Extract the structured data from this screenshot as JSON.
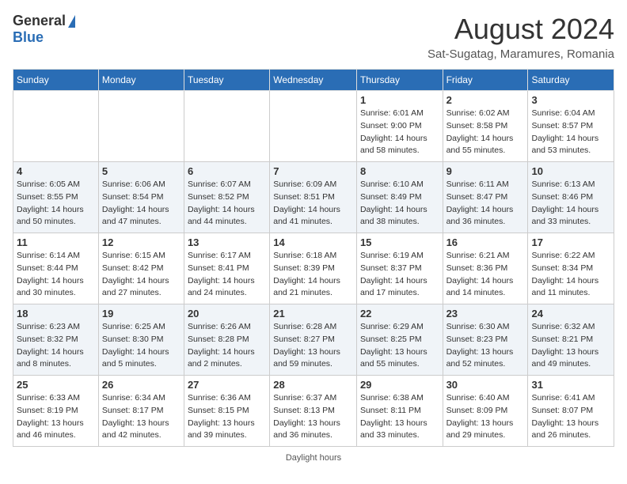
{
  "header": {
    "logo_general": "General",
    "logo_blue": "Blue",
    "month_title": "August 2024",
    "location": "Sat-Sugatag, Maramures, Romania"
  },
  "days_of_week": [
    "Sunday",
    "Monday",
    "Tuesday",
    "Wednesday",
    "Thursday",
    "Friday",
    "Saturday"
  ],
  "weeks": [
    [
      {
        "day": "",
        "info": ""
      },
      {
        "day": "",
        "info": ""
      },
      {
        "day": "",
        "info": ""
      },
      {
        "day": "",
        "info": ""
      },
      {
        "day": "1",
        "info": "Sunrise: 6:01 AM\nSunset: 9:00 PM\nDaylight: 14 hours\nand 58 minutes."
      },
      {
        "day": "2",
        "info": "Sunrise: 6:02 AM\nSunset: 8:58 PM\nDaylight: 14 hours\nand 55 minutes."
      },
      {
        "day": "3",
        "info": "Sunrise: 6:04 AM\nSunset: 8:57 PM\nDaylight: 14 hours\nand 53 minutes."
      }
    ],
    [
      {
        "day": "4",
        "info": "Sunrise: 6:05 AM\nSunset: 8:55 PM\nDaylight: 14 hours\nand 50 minutes."
      },
      {
        "day": "5",
        "info": "Sunrise: 6:06 AM\nSunset: 8:54 PM\nDaylight: 14 hours\nand 47 minutes."
      },
      {
        "day": "6",
        "info": "Sunrise: 6:07 AM\nSunset: 8:52 PM\nDaylight: 14 hours\nand 44 minutes."
      },
      {
        "day": "7",
        "info": "Sunrise: 6:09 AM\nSunset: 8:51 PM\nDaylight: 14 hours\nand 41 minutes."
      },
      {
        "day": "8",
        "info": "Sunrise: 6:10 AM\nSunset: 8:49 PM\nDaylight: 14 hours\nand 38 minutes."
      },
      {
        "day": "9",
        "info": "Sunrise: 6:11 AM\nSunset: 8:47 PM\nDaylight: 14 hours\nand 36 minutes."
      },
      {
        "day": "10",
        "info": "Sunrise: 6:13 AM\nSunset: 8:46 PM\nDaylight: 14 hours\nand 33 minutes."
      }
    ],
    [
      {
        "day": "11",
        "info": "Sunrise: 6:14 AM\nSunset: 8:44 PM\nDaylight: 14 hours\nand 30 minutes."
      },
      {
        "day": "12",
        "info": "Sunrise: 6:15 AM\nSunset: 8:42 PM\nDaylight: 14 hours\nand 27 minutes."
      },
      {
        "day": "13",
        "info": "Sunrise: 6:17 AM\nSunset: 8:41 PM\nDaylight: 14 hours\nand 24 minutes."
      },
      {
        "day": "14",
        "info": "Sunrise: 6:18 AM\nSunset: 8:39 PM\nDaylight: 14 hours\nand 21 minutes."
      },
      {
        "day": "15",
        "info": "Sunrise: 6:19 AM\nSunset: 8:37 PM\nDaylight: 14 hours\nand 17 minutes."
      },
      {
        "day": "16",
        "info": "Sunrise: 6:21 AM\nSunset: 8:36 PM\nDaylight: 14 hours\nand 14 minutes."
      },
      {
        "day": "17",
        "info": "Sunrise: 6:22 AM\nSunset: 8:34 PM\nDaylight: 14 hours\nand 11 minutes."
      }
    ],
    [
      {
        "day": "18",
        "info": "Sunrise: 6:23 AM\nSunset: 8:32 PM\nDaylight: 14 hours\nand 8 minutes."
      },
      {
        "day": "19",
        "info": "Sunrise: 6:25 AM\nSunset: 8:30 PM\nDaylight: 14 hours\nand 5 minutes."
      },
      {
        "day": "20",
        "info": "Sunrise: 6:26 AM\nSunset: 8:28 PM\nDaylight: 14 hours\nand 2 minutes."
      },
      {
        "day": "21",
        "info": "Sunrise: 6:28 AM\nSunset: 8:27 PM\nDaylight: 13 hours\nand 59 minutes."
      },
      {
        "day": "22",
        "info": "Sunrise: 6:29 AM\nSunset: 8:25 PM\nDaylight: 13 hours\nand 55 minutes."
      },
      {
        "day": "23",
        "info": "Sunrise: 6:30 AM\nSunset: 8:23 PM\nDaylight: 13 hours\nand 52 minutes."
      },
      {
        "day": "24",
        "info": "Sunrise: 6:32 AM\nSunset: 8:21 PM\nDaylight: 13 hours\nand 49 minutes."
      }
    ],
    [
      {
        "day": "25",
        "info": "Sunrise: 6:33 AM\nSunset: 8:19 PM\nDaylight: 13 hours\nand 46 minutes."
      },
      {
        "day": "26",
        "info": "Sunrise: 6:34 AM\nSunset: 8:17 PM\nDaylight: 13 hours\nand 42 minutes."
      },
      {
        "day": "27",
        "info": "Sunrise: 6:36 AM\nSunset: 8:15 PM\nDaylight: 13 hours\nand 39 minutes."
      },
      {
        "day": "28",
        "info": "Sunrise: 6:37 AM\nSunset: 8:13 PM\nDaylight: 13 hours\nand 36 minutes."
      },
      {
        "day": "29",
        "info": "Sunrise: 6:38 AM\nSunset: 8:11 PM\nDaylight: 13 hours\nand 33 minutes."
      },
      {
        "day": "30",
        "info": "Sunrise: 6:40 AM\nSunset: 8:09 PM\nDaylight: 13 hours\nand 29 minutes."
      },
      {
        "day": "31",
        "info": "Sunrise: 6:41 AM\nSunset: 8:07 PM\nDaylight: 13 hours\nand 26 minutes."
      }
    ]
  ],
  "footer": {
    "note": "Daylight hours"
  }
}
